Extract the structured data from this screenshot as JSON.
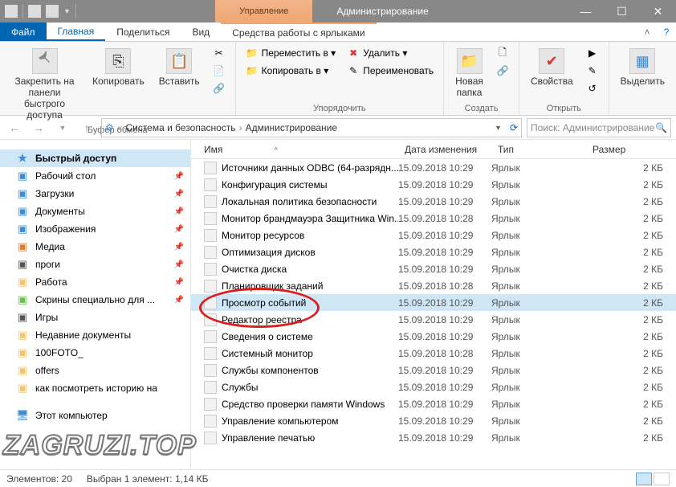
{
  "titlebar": {
    "contextual": "Управление",
    "title": "Администрирование"
  },
  "tabs": {
    "file": "Файл",
    "home": "Главная",
    "share": "Поделиться",
    "view": "Вид",
    "shortcut_tools": "Средства работы с ярлыками"
  },
  "ribbon": {
    "pin_label": "Закрепить на панели\nбыстрого доступа",
    "copy": "Копировать",
    "paste": "Вставить",
    "clipboard_group": "Буфер обмена",
    "move_to": "Переместить в ▾",
    "copy_to": "Копировать в ▾",
    "delete": "Удалить ▾",
    "rename": "Переименовать",
    "organize_group": "Упорядочить",
    "new_folder": "Новая\nпапка",
    "new_group": "Создать",
    "properties": "Свойства",
    "open_group": "Открыть",
    "select": "Выделить",
    "select_group": ""
  },
  "address": {
    "root": "Система и безопасность",
    "current": "Администрирование",
    "search_placeholder": "Поиск: Администрирование"
  },
  "columns": {
    "name": "Имя",
    "date": "Дата изменения",
    "type": "Тип",
    "size": "Размер"
  },
  "sidebar": {
    "quick": "Быстрый доступ",
    "items": [
      {
        "label": "Рабочий стол",
        "pin": true,
        "color": "#3a8bd8"
      },
      {
        "label": "Загрузки",
        "pin": true,
        "color": "#3a8bd8"
      },
      {
        "label": "Документы",
        "pin": true,
        "color": "#3a8bd8"
      },
      {
        "label": "Изображения",
        "pin": true,
        "color": "#3a8bd8"
      },
      {
        "label": "Медиа",
        "pin": true,
        "color": "#e07b2e"
      },
      {
        "label": "проги",
        "pin": true,
        "color": "#555"
      },
      {
        "label": "Работа",
        "pin": true,
        "color": "#f5c36a"
      },
      {
        "label": "Скрины специально для ...",
        "pin": true,
        "color": "#6abf4b"
      },
      {
        "label": "Игры",
        "pin": false,
        "color": "#555"
      },
      {
        "label": "Недавние документы",
        "pin": false,
        "color": "#f5c36a"
      },
      {
        "label": "100FOTO_",
        "pin": false,
        "color": "#f5c36a"
      },
      {
        "label": "offers",
        "pin": false,
        "color": "#f5c36a"
      },
      {
        "label": "как посмотреть историю на",
        "pin": false,
        "color": "#f5c36a"
      }
    ],
    "this_pc": "Этот компьютер"
  },
  "files": [
    {
      "name": "Источники данных ODBC (64-разрядн...",
      "date": "15.09.2018 10:29",
      "type": "Ярлык",
      "size": "2 КБ"
    },
    {
      "name": "Конфигурация системы",
      "date": "15.09.2018 10:29",
      "type": "Ярлык",
      "size": "2 КБ"
    },
    {
      "name": "Локальная политика безопасности",
      "date": "15.09.2018 10:29",
      "type": "Ярлык",
      "size": "2 КБ"
    },
    {
      "name": "Монитор брандмауэра Защитника Win...",
      "date": "15.09.2018 10:28",
      "type": "Ярлык",
      "size": "2 КБ"
    },
    {
      "name": "Монитор ресурсов",
      "date": "15.09.2018 10:29",
      "type": "Ярлык",
      "size": "2 КБ"
    },
    {
      "name": "Оптимизация дисков",
      "date": "15.09.2018 10:29",
      "type": "Ярлык",
      "size": "2 КБ"
    },
    {
      "name": "Очистка диска",
      "date": "15.09.2018 10:29",
      "type": "Ярлык",
      "size": "2 КБ"
    },
    {
      "name": "Планировщик заданий",
      "date": "15.09.2018 10:28",
      "type": "Ярлык",
      "size": "2 КБ"
    },
    {
      "name": "Просмотр событий",
      "date": "15.09.2018 10:29",
      "type": "Ярлык",
      "size": "2 КБ",
      "selected": true
    },
    {
      "name": "Редактор реестра",
      "date": "15.09.2018 10:29",
      "type": "Ярлык",
      "size": "2 КБ"
    },
    {
      "name": "Сведения о системе",
      "date": "15.09.2018 10:29",
      "type": "Ярлык",
      "size": "2 КБ"
    },
    {
      "name": "Системный монитор",
      "date": "15.09.2018 10:28",
      "type": "Ярлык",
      "size": "2 КБ"
    },
    {
      "name": "Службы компонентов",
      "date": "15.09.2018 10:29",
      "type": "Ярлык",
      "size": "2 КБ"
    },
    {
      "name": "Службы",
      "date": "15.09.2018 10:29",
      "type": "Ярлык",
      "size": "2 КБ"
    },
    {
      "name": "Средство проверки памяти Windows",
      "date": "15.09.2018 10:29",
      "type": "Ярлык",
      "size": "2 КБ"
    },
    {
      "name": "Управление компьютером",
      "date": "15.09.2018 10:29",
      "type": "Ярлык",
      "size": "2 КБ"
    },
    {
      "name": "Управление печатью",
      "date": "15.09.2018 10:29",
      "type": "Ярлык",
      "size": "2 КБ"
    }
  ],
  "statusbar": {
    "count": "Элементов: 20",
    "selection": "Выбран 1 элемент: 1,14 КБ"
  },
  "watermark": "ZAGRUZI.TOP"
}
